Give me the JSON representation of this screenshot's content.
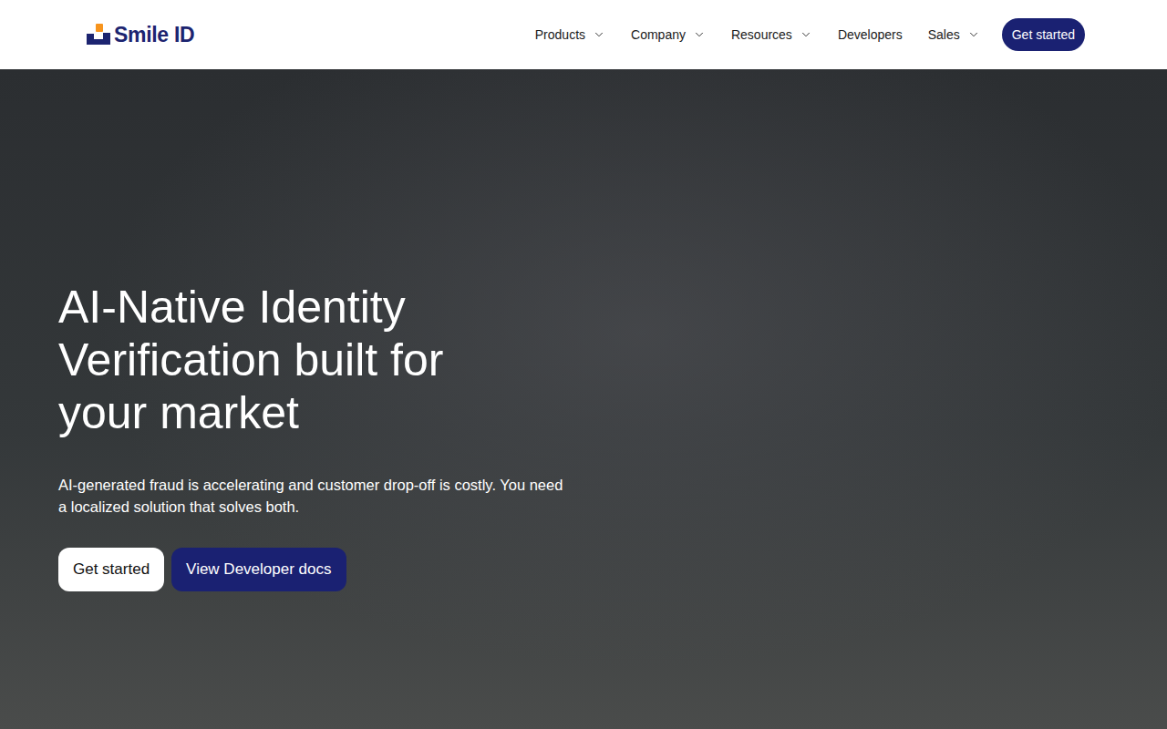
{
  "header": {
    "logo": "Smile ID",
    "nav": [
      {
        "label": "Products",
        "dropdown": true
      },
      {
        "label": "Company",
        "dropdown": true
      },
      {
        "label": "Resources",
        "dropdown": true
      },
      {
        "label": "Developers",
        "dropdown": false
      },
      {
        "label": "Sales",
        "dropdown": true
      }
    ],
    "cta": "Get started"
  },
  "hero": {
    "title": "AI-Native Identity Verification built for your market",
    "subtitle": "AI-generated fraud is accelerating and customer drop-off is costly. You need a localized solution that solves both.",
    "buttons": [
      {
        "label": "Get started",
        "kind": "primary"
      },
      {
        "label": "View Developer docs",
        "kind": "secondary"
      }
    ]
  }
}
